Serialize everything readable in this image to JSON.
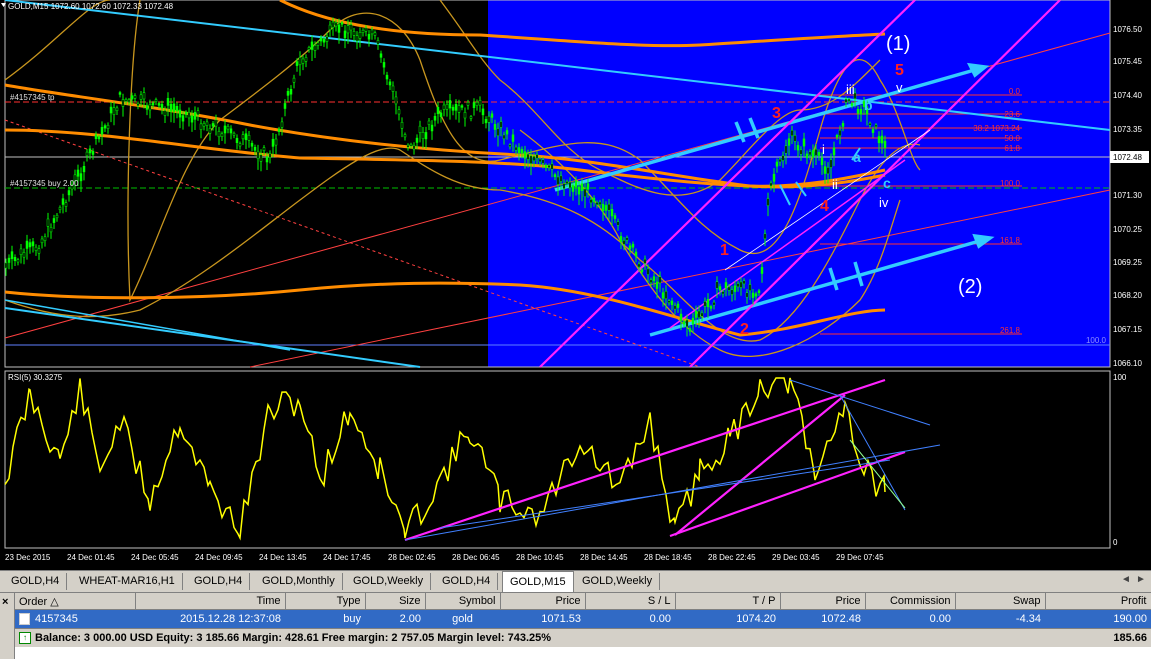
{
  "window": {
    "title": "GOLD,M15",
    "ohlc": "1072.60 1072.60 1072.33 1072.48"
  },
  "main_chart": {
    "price_labels": [
      "1076.50",
      "1075.45",
      "1074.40",
      "1073.35",
      "1072.48",
      "1071.30",
      "1070.25",
      "1069.25",
      "1068.20",
      "1067.15",
      "1066.10"
    ],
    "tp_label": "#4157345 tp",
    "buy_label": "#4157345 buy 2.00",
    "wave_labels": {
      "w1": "(1)",
      "w2": "(2)",
      "w5": "5",
      "w3": "3",
      "w4": "4",
      "r1": "1",
      "r2": "2",
      "iii": "iii",
      "v": "v",
      "i": "i",
      "ii": "ii",
      "iv": "iv",
      "a": "a",
      "b": "b",
      "c": "c"
    },
    "fib_labels": [
      "0.0",
      "23.6",
      "38.2 1073.24",
      "50.0",
      "61.8",
      "100.0",
      "161.8",
      "261.8",
      "100.0"
    ],
    "current_price": "1072.48"
  },
  "rsi": {
    "title": "RSI(5) 30.3275",
    "levels": [
      "100",
      "0"
    ]
  },
  "time_axis": [
    "23 Dec 2015",
    "24 Dec 01:45",
    "24 Dec 05:45",
    "24 Dec 09:45",
    "24 Dec 13:45",
    "24 Dec 17:45",
    "28 Dec 02:45",
    "28 Dec 06:45",
    "28 Dec 10:45",
    "28 Dec 14:45",
    "28 Dec 18:45",
    "28 Dec 22:45",
    "29 Dec 03:45",
    "29 Dec 07:45"
  ],
  "chart_tabs": [
    "GOLD,H4",
    "WHEAT-MAR16,H1",
    "GOLD,H4",
    "GOLD,Monthly",
    "GOLD,Weekly",
    "GOLD,H4",
    "GOLD,M15",
    "GOLD,Weekly"
  ],
  "active_tab": "GOLD,M15",
  "terminal": {
    "columns": [
      "Order",
      "Time",
      "Type",
      "Size",
      "Symbol",
      "Price",
      "S / L",
      "T / P",
      "Price",
      "Commission",
      "Swap",
      "Profit"
    ],
    "order": {
      "order": "4157345",
      "time": "2015.12.28 12:37:08",
      "type": "buy",
      "size": "2.00",
      "symbol": "gold",
      "price": "1071.53",
      "sl": "0.00",
      "tp": "1074.20",
      "current_price": "1072.48",
      "commission": "0.00",
      "swap": "-4.34",
      "profit": "190.00"
    },
    "balance_text": "Balance: 3 000.00 USD  Equity: 3 185.66  Margin: 428.61  Free margin: 2 757.05  Margin level: 743.25%",
    "balance_profit": "185.66"
  },
  "colors": {
    "blue_zone": "#0000ff",
    "candle": "#00ff00",
    "bands": "#c8961e",
    "ma_orange": "#ff8c00",
    "cyan": "#33ccff",
    "magenta": "#ff22ff",
    "rsi_line": "#ffff00",
    "selection": "#316ac5"
  }
}
